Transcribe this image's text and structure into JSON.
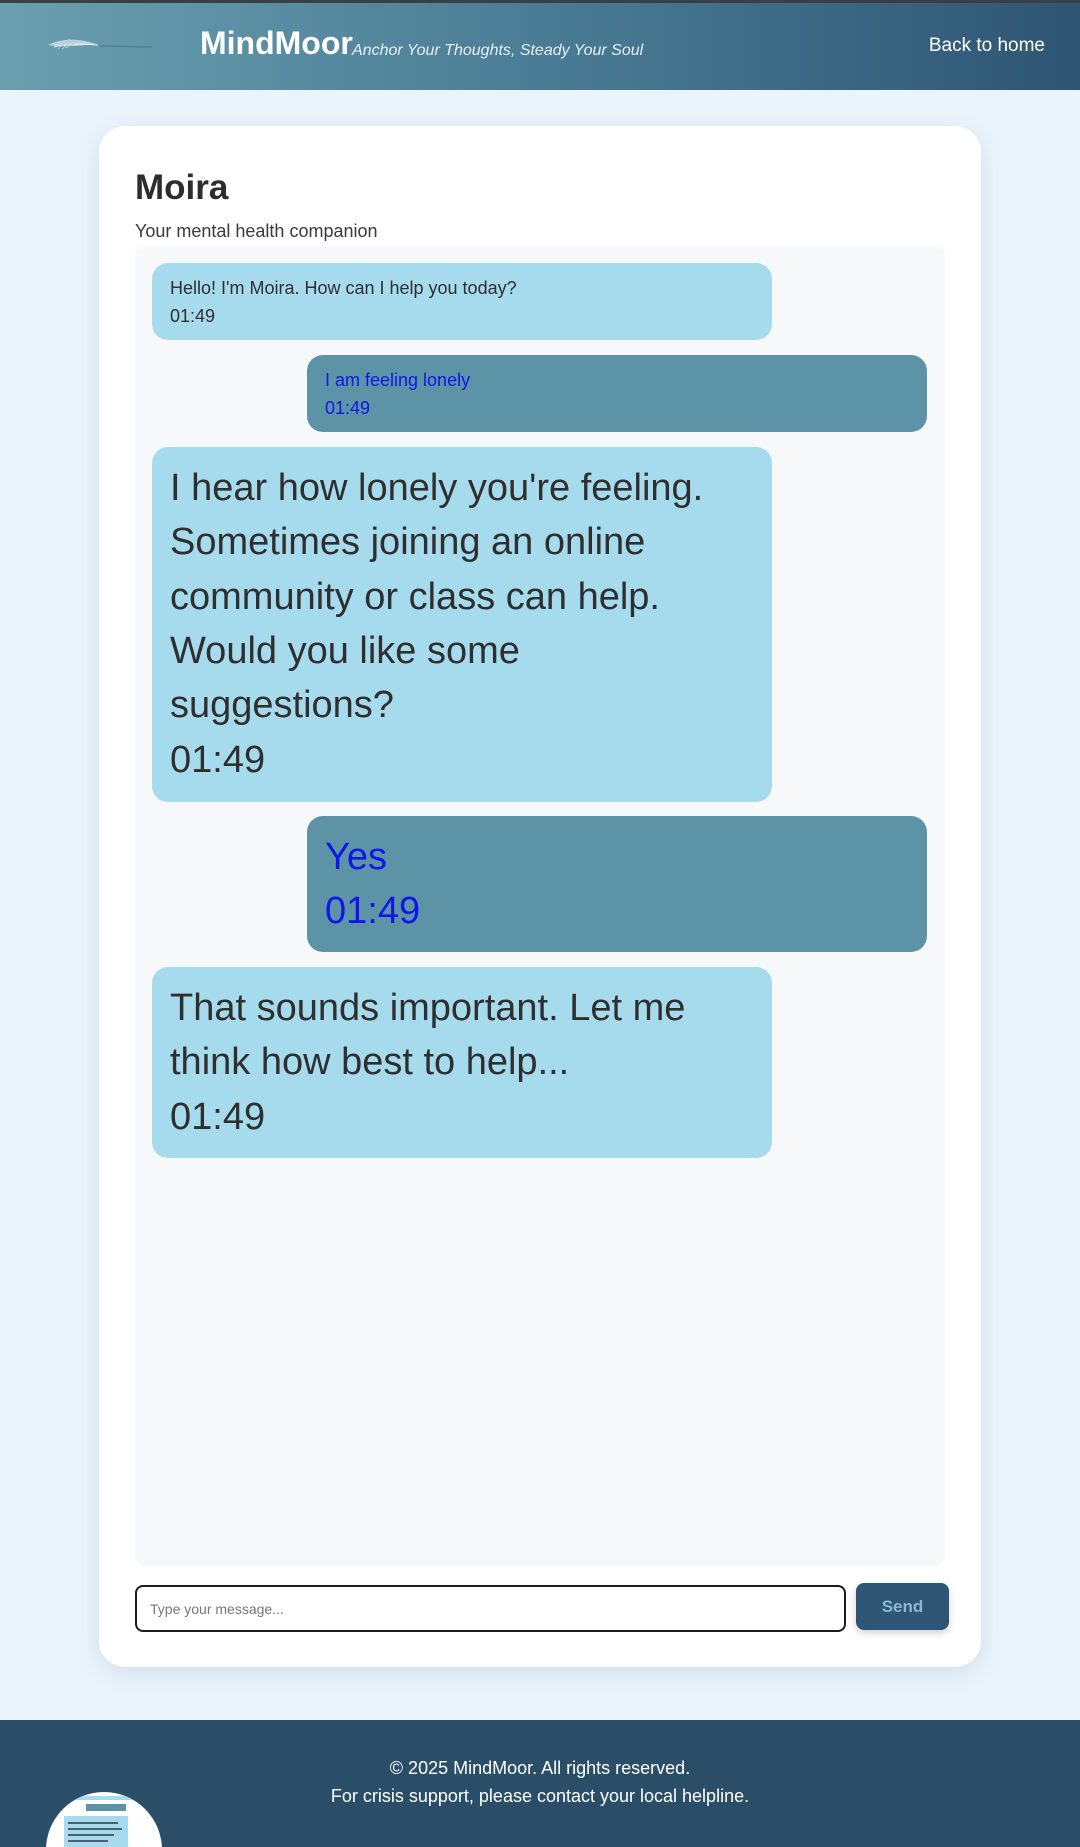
{
  "header": {
    "brand": "MindMoor",
    "tagline": "Anchor Your Thoughts, Steady Your Soul",
    "back_link": "Back to home"
  },
  "chat": {
    "title": "Moira",
    "subtitle": "Your mental health companion",
    "messages": [
      {
        "sender": "bot",
        "text": "Hello! I'm Moira. How can I help you today?",
        "time": "01:49"
      },
      {
        "sender": "user",
        "text": "I am feeling lonely",
        "time": "01:49"
      },
      {
        "sender": "bot",
        "text": "I hear how lonely you're feeling. Sometimes joining an online community or class can help. Would you like some suggestions?",
        "time": "01:49"
      },
      {
        "sender": "user",
        "text": "Yes",
        "time": "01:49"
      },
      {
        "sender": "bot",
        "text": "That sounds important. Let me think how best to help...",
        "time": "01:49"
      }
    ],
    "input_placeholder": "Type your message...",
    "input_value": "",
    "send_label": "Send"
  },
  "footer": {
    "copyright": "© 2025 MindMoor. All rights reserved.",
    "crisis": "For crisis support, please contact your local helpline."
  },
  "colors": {
    "bot_bubble": "#a6dbee",
    "user_bubble": "#5d93a6",
    "user_text": "#0f17e8",
    "footer_bg": "#2a4e68",
    "send_button": "#2e5574"
  }
}
